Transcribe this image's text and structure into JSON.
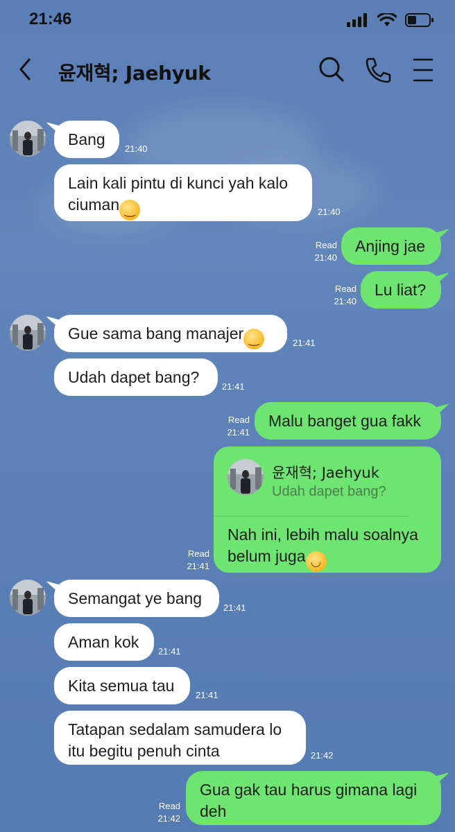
{
  "status_bar": {
    "time": "21:46"
  },
  "header": {
    "title": "윤재혁; Jaehyuk"
  },
  "messages": [
    {
      "text": "Bang",
      "time": "21:40"
    },
    {
      "text": "Lain kali pintu di kunci yah kalo",
      "text2": "ciuman",
      "time": "21:40"
    },
    {
      "text": "Anjing jae",
      "status": "Read",
      "time": "21:40"
    },
    {
      "text": "Lu liat?",
      "status": "Read",
      "time": "21:40"
    },
    {
      "text": "Gue sama bang manajer",
      "time": "21:41"
    },
    {
      "text": "Udah dapet bang?",
      "time": "21:41"
    },
    {
      "text": "Malu banget gua fakk",
      "status": "Read",
      "time": "21:41"
    },
    {
      "reply_name": "윤재혁; Jaehyuk",
      "reply_quote": "Udah dapet bang?",
      "text": "Nah ini, lebih malu soalnya",
      "text2": "belum juga",
      "status": "Read",
      "time": "21:41"
    },
    {
      "text": "Semangat ye bang",
      "time": "21:41"
    },
    {
      "text": "Aman kok",
      "time": "21:41"
    },
    {
      "text": "Kita semua tau",
      "time": "21:41"
    },
    {
      "text": "Tatapan sedalam samudera lo",
      "text2": "itu begitu penuh cinta",
      "time": "21:42"
    },
    {
      "text": "Gua gak tau harus gimana lagi",
      "text2": "deh",
      "status": "Read",
      "time": "21:42"
    }
  ],
  "icons": [
    "back-icon",
    "search-icon",
    "phone-icon",
    "menu-icon"
  ],
  "colors": {
    "background": "#5b7fb6",
    "my_bubble": "#6de570",
    "their_bubble": "#ffffff"
  }
}
